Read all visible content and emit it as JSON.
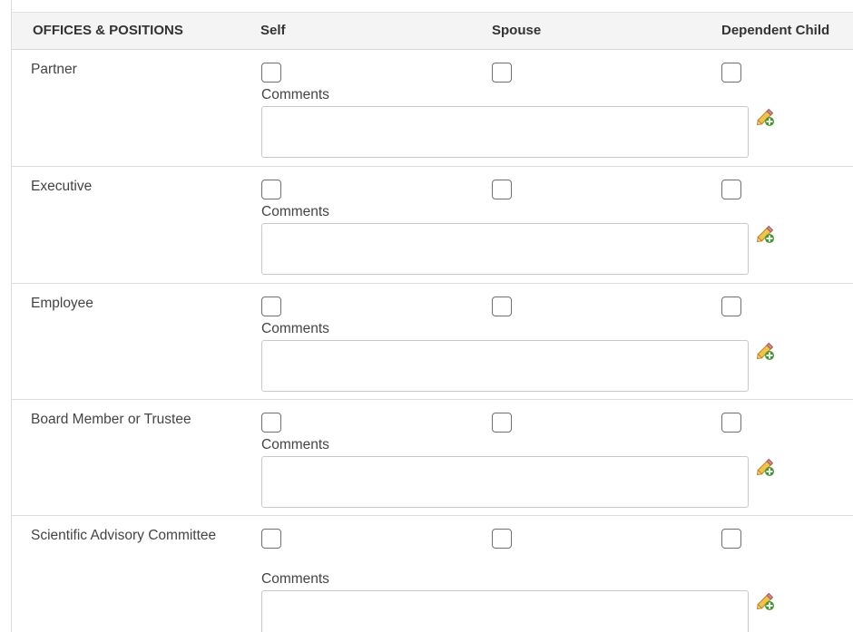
{
  "table": {
    "headers": {
      "label": "OFFICES & POSITIONS",
      "self": "Self",
      "spouse": "Spouse",
      "dependent": "Dependent Child"
    },
    "comments_label": "Comments",
    "comments_value": "",
    "edit_icon": "pencil-add-icon",
    "rows": [
      {
        "label": "Partner",
        "self": false,
        "spouse": false,
        "dependent": false
      },
      {
        "label": "Executive",
        "self": false,
        "spouse": false,
        "dependent": false
      },
      {
        "label": "Employee",
        "self": false,
        "spouse": false,
        "dependent": false
      },
      {
        "label": "Board Member or Trustee",
        "self": false,
        "spouse": false,
        "dependent": false
      },
      {
        "label": "Scientific Advisory Committee",
        "self": false,
        "spouse": false,
        "dependent": false
      }
    ]
  },
  "colors": {
    "header_bg": "#f4f4f4",
    "row_border": "#dcdcdc",
    "checkbox_border": "#6f6f6f",
    "icon_pencil": "#e8b84a",
    "icon_plus": "#3e9a2a"
  }
}
